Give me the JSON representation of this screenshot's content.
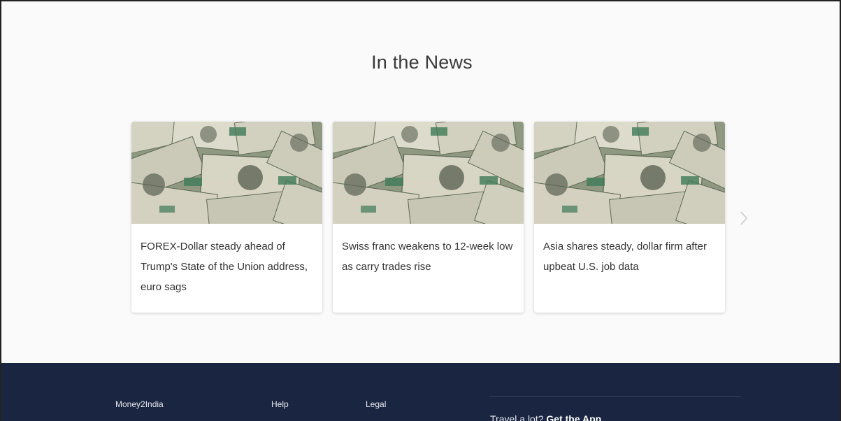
{
  "news": {
    "title": "In the News",
    "cards": [
      {
        "headline": "FOREX-Dollar steady ahead of Trump's State of the Union address, euro sags",
        "image": "dollar-bills-photo"
      },
      {
        "headline": "Swiss franc weakens to 12-week low as carry trades rise",
        "image": "dollar-bills-photo"
      },
      {
        "headline": "Asia shares steady, dollar firm after upbeat U.S. job data",
        "image": "dollar-bills-photo"
      }
    ],
    "next_icon": "chevron-right-icon"
  },
  "footer": {
    "columns": [
      {
        "title": "Money2India"
      },
      {
        "title": "Help"
      },
      {
        "title": "Legal"
      }
    ],
    "app_prompt": "Travel a lot?",
    "app_cta": "Get the App.",
    "background_color": "#1a2641"
  }
}
